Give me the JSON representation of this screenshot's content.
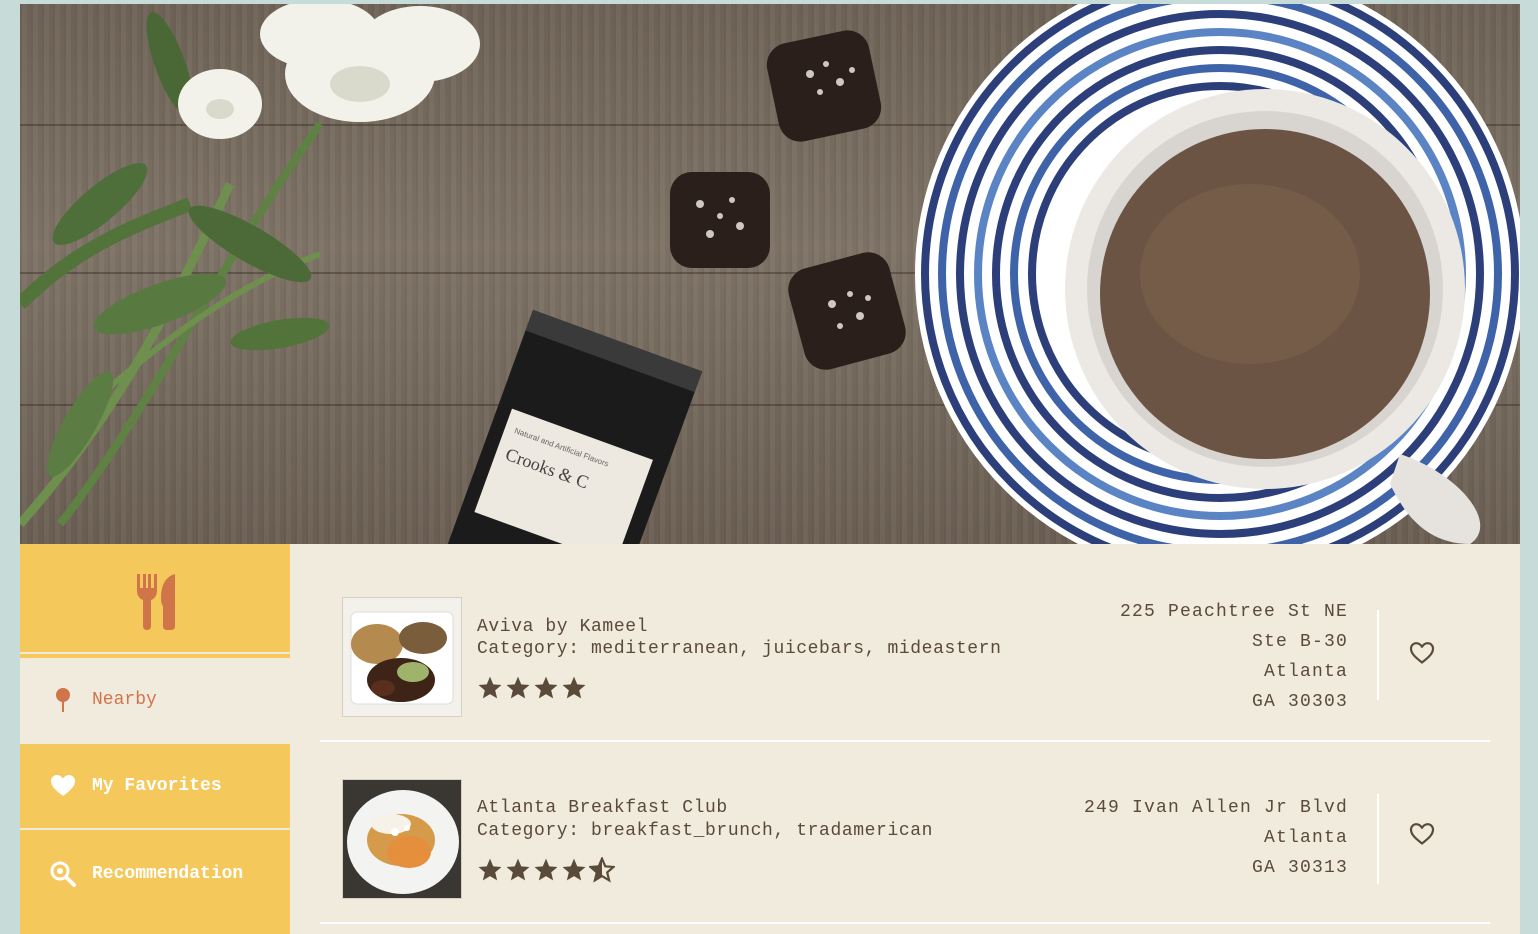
{
  "sidebar": {
    "logo_icon": "fork-knife-icon",
    "items": [
      {
        "label": "Nearby",
        "icon": "map-pin-icon",
        "active": true
      },
      {
        "label": "My Favorites",
        "icon": "heart-icon",
        "active": false
      },
      {
        "label": "Recommendation",
        "icon": "search-icon",
        "active": false
      }
    ]
  },
  "hero": {
    "packet_text": "Crooks & C",
    "packet_subtext": "Natural and Artificial Flavors"
  },
  "results": [
    {
      "name": "Aviva by Kameel",
      "category": "Category: mediterranean, juicebars, mideastern",
      "rating": 4,
      "address": [
        "225 Peachtree St NE",
        "Ste B-30",
        "Atlanta",
        "GA 30303"
      ],
      "favorite": false
    },
    {
      "name": "Atlanta Breakfast Club",
      "category": "Category: breakfast_brunch, tradamerican",
      "rating": 4.5,
      "address": [
        "249 Ivan Allen Jr Blvd",
        "Atlanta",
        "GA 30313"
      ],
      "favorite": false
    }
  ],
  "colors": {
    "accent": "#d0744a",
    "sidebar_bg": "#f5c85c",
    "content_bg": "#f1ebdd",
    "text": "#5a4a3a",
    "star": "#5a4a3a"
  }
}
